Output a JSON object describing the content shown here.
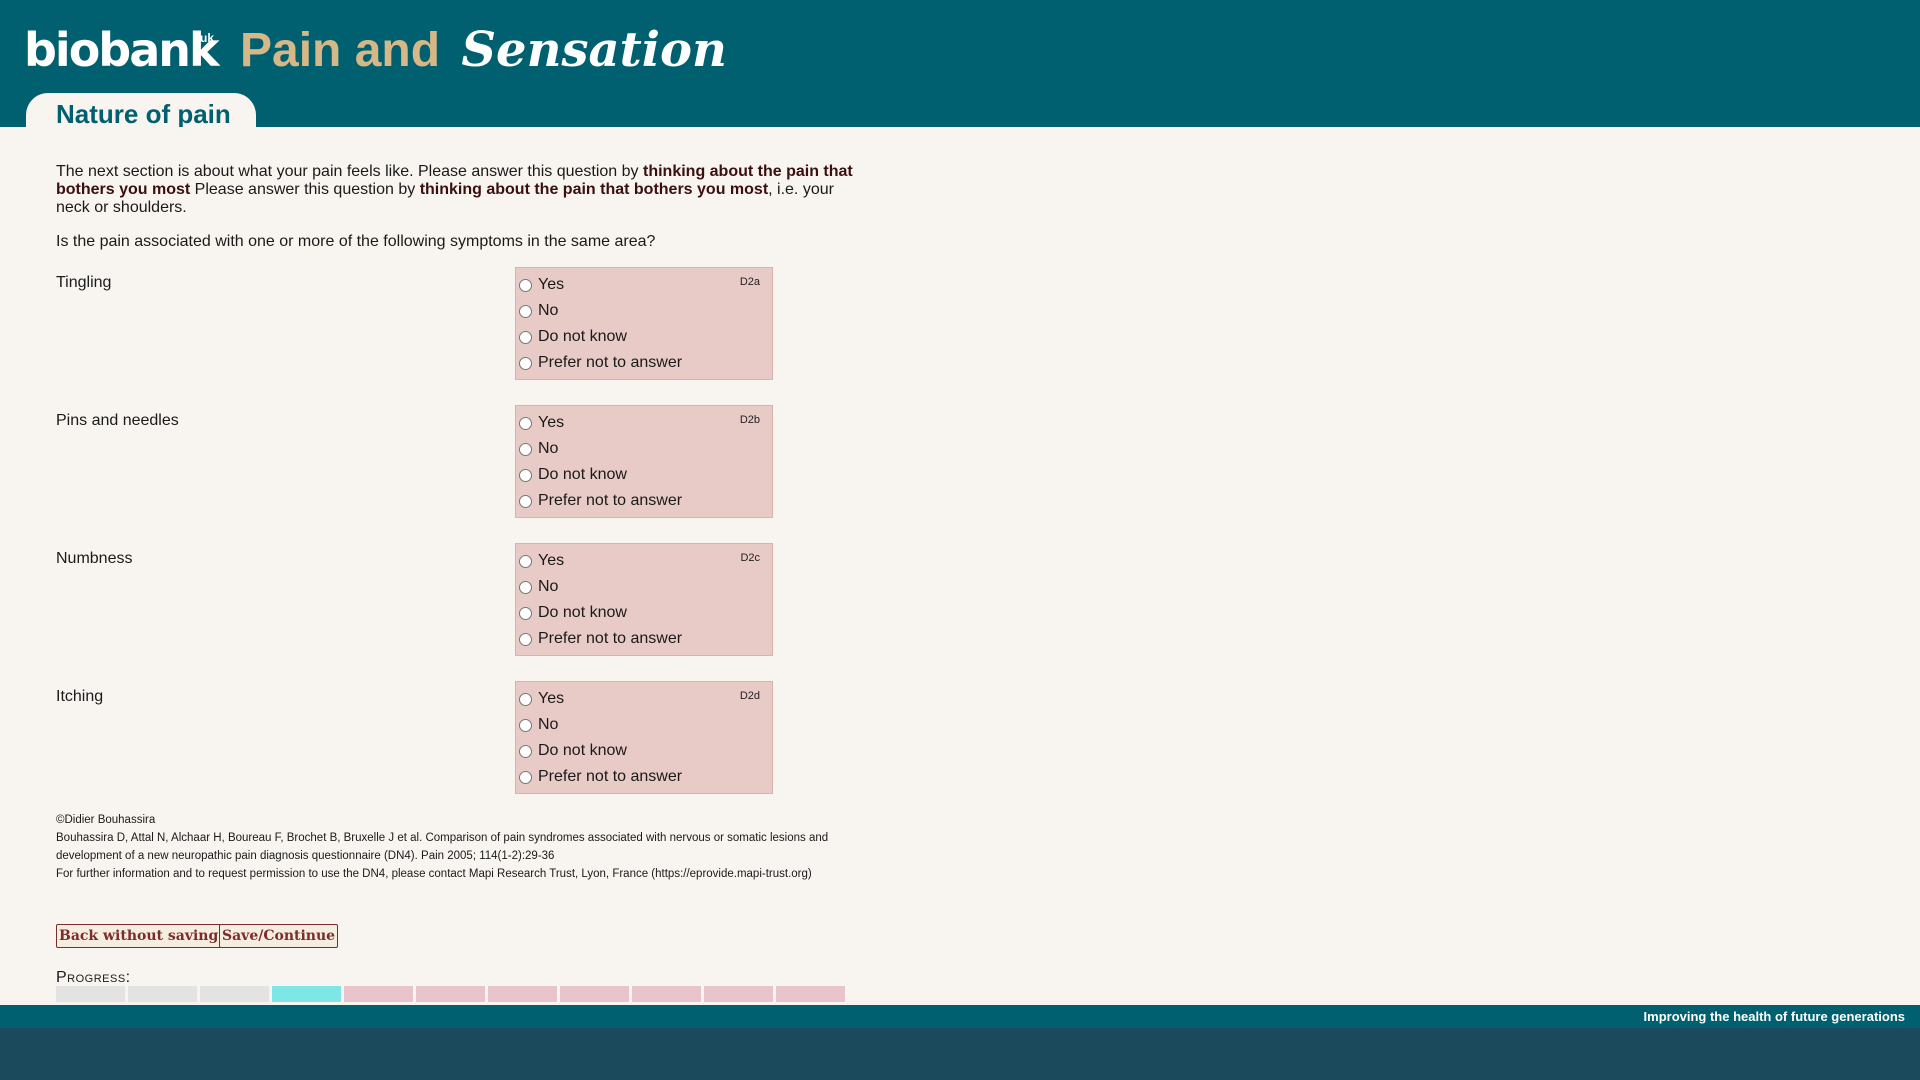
{
  "header": {
    "logo_text": "biobank",
    "logo_sup": "uk",
    "title_part1": "Pain and",
    "title_part2": "Sensation",
    "page_tab": "Nature of pain"
  },
  "intro": {
    "lead": "The next section is about what your pain feels like. Please answer this question by ",
    "bold1": "thinking about the pain that bothers you most",
    "middle": " Please answer this question by ",
    "bold2": "thinking about the pain that bothers you most",
    "tail": ", i.e. your neck or shoulders."
  },
  "question": "Is the pain associated with one or more of the following symptoms in the same area?",
  "items": [
    {
      "label": "Tingling",
      "code": "D2a",
      "options": [
        "Yes",
        "No",
        "Do not know",
        "Prefer not to answer"
      ]
    },
    {
      "label": "Pins and needles",
      "code": "D2b",
      "options": [
        "Yes",
        "No",
        "Do not know",
        "Prefer not to answer"
      ]
    },
    {
      "label": "Numbness",
      "code": "D2c",
      "options": [
        "Yes",
        "No",
        "Do not know",
        "Prefer not to answer"
      ]
    },
    {
      "label": "Itching",
      "code": "D2d",
      "options": [
        "Yes",
        "No",
        "Do not know",
        "Prefer not to answer"
      ]
    }
  ],
  "credits": [
    "©Didier Bouhassira",
    "Bouhassira D, Attal N, Alchaar H, Boureau F, Brochet B, Bruxelle J et al. Comparison of pain syndromes associated with nervous or somatic lesions and development of a new neuropathic pain diagnosis questionnaire (DN4). Pain 2005; 114(1-2):29-36",
    "For further information and to request permission to use the DN4, please contact Mapi Research Trust, Lyon, France (https://eprovide.mapi-trust.org)"
  ],
  "buttons": {
    "back": "Back without saving",
    "save": "Save/Continue"
  },
  "progress": {
    "label": "Progress:",
    "segments": [
      "done",
      "done",
      "done",
      "current",
      "todo",
      "todo",
      "todo",
      "todo",
      "todo",
      "todo",
      "todo"
    ],
    "colors": {
      "done": "#e3e3e3",
      "current": "#7fe6e6",
      "todo": "#e8c4cc"
    }
  },
  "footer": {
    "tagline": "Improving the health of future generations"
  },
  "colors": {
    "header_bg": "#00606f",
    "title_accent": "#d6b787",
    "page_bg": "#f8f5f0",
    "answer_box": "#e8cac6",
    "button_text": "#7a2d2d"
  }
}
